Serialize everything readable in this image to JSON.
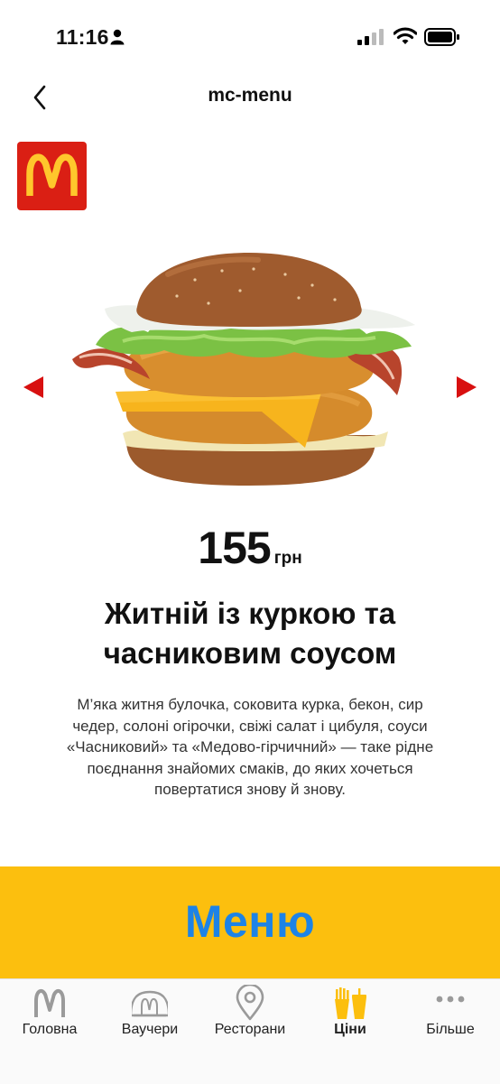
{
  "status_bar": {
    "time": "11:16"
  },
  "nav": {
    "title": "mc-menu"
  },
  "product": {
    "price": "155",
    "currency": "грн",
    "title_line1": "Житній із куркою та",
    "title_line2": "часниковим соусом",
    "description_lines": [
      "М’яка житня булочка, соковита курка, бекон, сир",
      "чедер, солоні огірочки, свіжі салат і цибуля, соуси",
      "«Часниковий» та «Медово-гірчичний» — таке рідне",
      "поєднання знайомих смаків, до яких хочеться",
      "повертатися знову й знову."
    ]
  },
  "menu_banner": {
    "label": "Меню"
  },
  "tabs": [
    {
      "label": "Головна",
      "icon": "arches-icon"
    },
    {
      "label": "Ваучери",
      "icon": "voucher-icon"
    },
    {
      "label": "Ресторани",
      "icon": "location-pin-icon"
    },
    {
      "label": "Ціни",
      "icon": "food-icon"
    },
    {
      "label": "Більше",
      "icon": "more-icon"
    }
  ],
  "active_tab": "Ціни",
  "colors": {
    "brand_red": "#da1f14",
    "brand_yellow": "#fcbf0e",
    "menu_text_blue": "#1d83e6",
    "arrow_red": "#d81010"
  }
}
